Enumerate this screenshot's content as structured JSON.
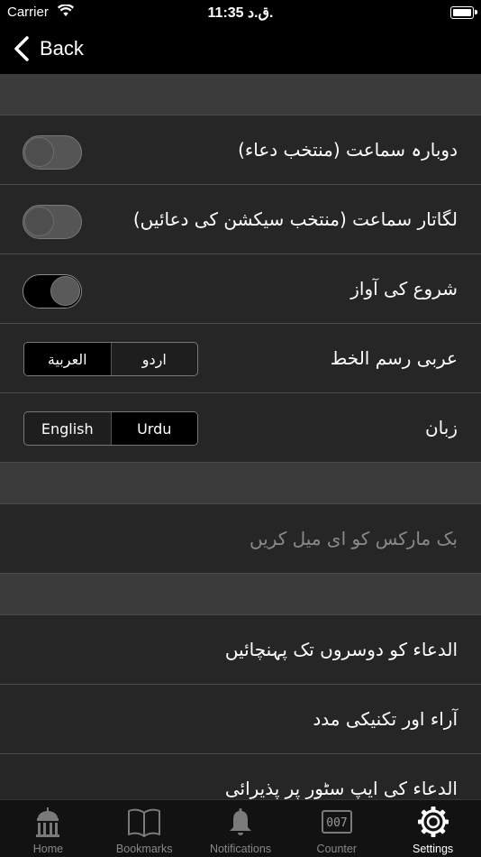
{
  "status_bar": {
    "carrier": "Carrier",
    "time": "11:35 ق.د.",
    "battery_level": 1.0
  },
  "nav": {
    "back_label": "Back"
  },
  "settings": {
    "toggles": [
      {
        "label": "دوبارہ سماعت (منتخب دعاء)",
        "on": false
      },
      {
        "label": "لگاتار سماعت (منتخب سیکشن کی دعائیں)",
        "on": false
      },
      {
        "label": "شروع کی آواز",
        "on": true
      }
    ],
    "arabic_script": {
      "label": "عربی رسم الخط",
      "options": [
        "العربية",
        "اردو"
      ],
      "selected": "العربية"
    },
    "language": {
      "label": "زبان",
      "options": [
        "English",
        "Urdu"
      ],
      "selected": "Urdu"
    },
    "email_bookmarks": "بک مارکس کو ای میل کریں",
    "links": [
      "الدعاء کو دوسروں تک پہنچائیں",
      "آراء اور تکنیکی مدد",
      "الدعاء کی ایپ سٹور پر پذیرائی"
    ]
  },
  "tabs": [
    {
      "label": "Home",
      "icon": "home-icon",
      "active": false
    },
    {
      "label": "Bookmarks",
      "icon": "bookmarks-icon",
      "active": false
    },
    {
      "label": "Notifications",
      "icon": "bell-icon",
      "active": false
    },
    {
      "label": "Counter",
      "icon": "counter-icon",
      "counter_text": "007",
      "active": false
    },
    {
      "label": "Settings",
      "icon": "gear-icon",
      "active": true
    }
  ],
  "colors": {
    "background": "#262626",
    "section_gap": "#3b3b3b",
    "separator": "#4c4c4c",
    "text": "#ffffff",
    "dim_text": "#8a8a8a"
  }
}
